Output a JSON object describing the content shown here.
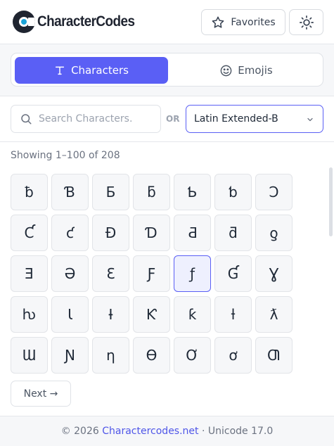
{
  "header": {
    "logo_text": "CharacterCodes",
    "favorites_label": "Favorites"
  },
  "tabs": {
    "characters_label": "Characters",
    "emojis_label": "Emojis",
    "active": "characters"
  },
  "search": {
    "placeholder": "Search Characters.",
    "value": "",
    "or_label": "OR",
    "block_selected": "Latin Extended-B"
  },
  "results": {
    "showing_text": "Showing 1–100 of 208",
    "selected_index": 18,
    "characters": [
      "ƀ",
      "Ɓ",
      "Ƃ",
      "ƃ",
      "Ƅ",
      "ƅ",
      "Ɔ",
      "Ƈ",
      "ƈ",
      "Ɖ",
      "Ɗ",
      "Ƌ",
      "ƌ",
      "ƍ",
      "Ǝ",
      "Ə",
      "Ɛ",
      "Ƒ",
      "ƒ",
      "Ɠ",
      "Ɣ",
      "ƕ",
      "Ɩ",
      "Ɨ",
      "Ƙ",
      "ƙ",
      "ƚ",
      "ƛ",
      "Ɯ",
      "Ɲ",
      "ƞ",
      "Ɵ",
      "Ơ",
      "ơ",
      "Ƣ"
    ]
  },
  "pagination": {
    "next_label": "Next →"
  },
  "footer": {
    "copyright": "© 2026 ",
    "site_link": "Charactercodes.net",
    "unicode_text": " · Unicode 17.0"
  },
  "colors": {
    "accent": "#5a5ff5",
    "link": "#4f56e8",
    "logo_dot": "#1aa3d8"
  }
}
